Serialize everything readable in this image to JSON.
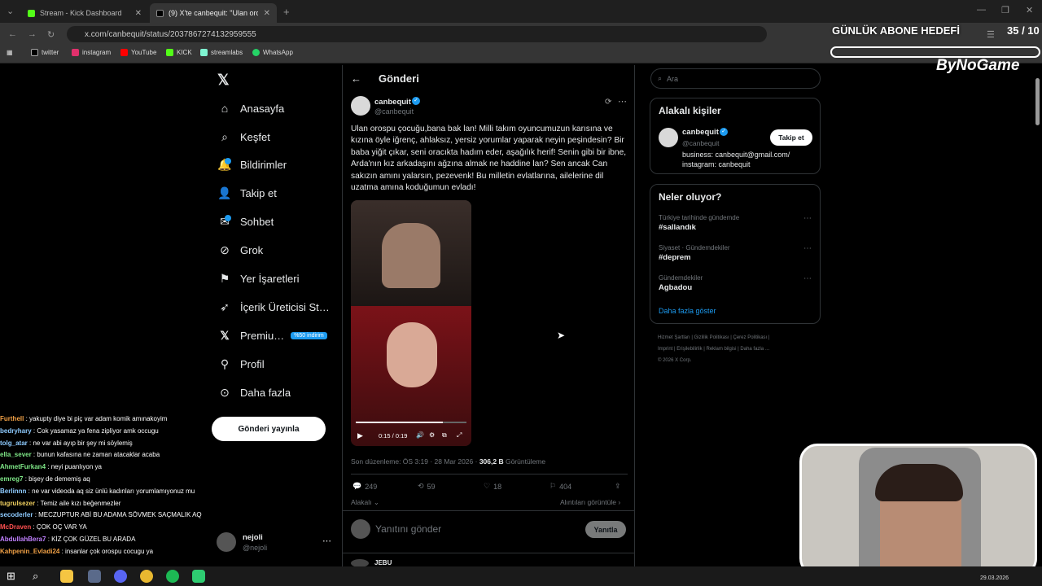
{
  "browser": {
    "tabs": [
      {
        "label": "Stream - Kick Dashboard"
      },
      {
        "label": "(9) X'te canbequit: \"Ulan orosp…"
      }
    ],
    "url": "x.com/canbequit/status/2037867274132959555",
    "bookmarks": [
      "twitter",
      "instagram",
      "YouTube",
      "KICK",
      "streamlabs",
      "WhatsApp"
    ]
  },
  "overlay": {
    "goal_title": "GÜNLÜK ABONE HEDEFİ",
    "goal_count": "35 / 10",
    "brand": "ByNoGame"
  },
  "sidebar": {
    "items": [
      {
        "label": "Anasayfa",
        "icon": "home-icon"
      },
      {
        "label": "Keşfet",
        "icon": "search-icon"
      },
      {
        "label": "Bildirimler",
        "icon": "bell-icon"
      },
      {
        "label": "Takip et",
        "icon": "follow-icon"
      },
      {
        "label": "Sohbet",
        "icon": "mail-icon"
      },
      {
        "label": "Grok",
        "icon": "grok-icon"
      },
      {
        "label": "Yer İşaretleri",
        "icon": "bookmark-icon"
      },
      {
        "label": "İçerik Üreticisi St…",
        "icon": "rocket-icon"
      },
      {
        "label": "Premiu…",
        "icon": "x-logo-icon"
      },
      {
        "label": "Profil",
        "icon": "person-icon"
      },
      {
        "label": "Daha fazla",
        "icon": "more-circle-icon"
      }
    ],
    "premium_badge": "%50 indirim",
    "post_button": "Gönderi yayınla",
    "account": {
      "name": "nejoli",
      "handle": "@nejoli"
    }
  },
  "chat": [
    {
      "user": "Furthell",
      "color": "#f0a046",
      "msg": "yakupty diye bi piç var adam komik amınakoyim"
    },
    {
      "user": "bedryhary",
      "color": "#8ecbff",
      "msg": "Cok yasamaz ya fena zipliyor amk occugu"
    },
    {
      "user": "tolg_atar",
      "color": "#8ecbff",
      "msg": "ne var abi ayıp bir şey mi söylemiş"
    },
    {
      "user": "ella_sever",
      "color": "#7ee787",
      "msg": "bunun kafasına ne zaman atacaklar acaba"
    },
    {
      "user": "AhmetFurkan4",
      "color": "#7ee787",
      "msg": "neyi puanlıyon ya"
    },
    {
      "user": "emreg7",
      "color": "#7ee787",
      "msg": "bişey de dememiş aq"
    },
    {
      "user": "Berlinnn",
      "color": "#8ecbff",
      "msg": "ne var videoda aq siz ünlü kadınları yorumlamıyonuz mu"
    },
    {
      "user": "tugrulsezer",
      "color": "#f0d060",
      "msg": "Temiz aile kızı beğenmezler"
    },
    {
      "user": "secoderler",
      "color": "#8ecbff",
      "msg": "MECZUPTUR ABİ BU ADAMA SÖVMEK SAÇMALIK AQ"
    },
    {
      "user": "McDraven",
      "color": "#ff5050",
      "msg": "ÇOK OÇ VAR YA"
    },
    {
      "user": "AbdullahBera7",
      "color": "#c080ff",
      "msg": "KİZ ÇOK GÜZEL BU ARADA"
    },
    {
      "user": "Kahpenin_Evladi24",
      "color": "#f0a046",
      "msg": "insanlar çok orospu cocugu ya"
    }
  ],
  "post": {
    "header": "Gönderi",
    "author": {
      "name": "canbequit",
      "handle": "@canbequit"
    },
    "text": "Ulan orospu çocuğu,bana bak lan! Milli takım oyuncumuzun karısına ve kızına öyle iğrenç, ahlaksız, yersiz yorumlar yaparak neyin peşindesin? Bir baba yiğit çıkar, seni oracıkta hadım eder, aşağılık herif! Senin gibi bir ibne, Arda'nın kız arkadaşını ağzına almak ne haddine lan? Sen ancak Can sakızın amını yalarsın, pezevenk! Bu milletin evlatlarına, ailelerine dil uzatma amına koduğumun evladı!",
    "video_time": "0:15 / 0:19",
    "video_progress": 0.79,
    "edited": "Son düzenleme: ÖS 3:19 · 28 Mar 2026 · ",
    "views": "306,2 B",
    "views_label": "Görüntüleme",
    "replies": "249",
    "reposts": "59",
    "likes": "18",
    "bookmarks": "404",
    "related": "Alakalı",
    "quotes": "Alıntıları görüntüle",
    "reply_placeholder": "Yanıtını gönder",
    "reply_button": "Yanıtla",
    "next_author": "JEBU"
  },
  "right": {
    "search_placeholder": "Ara",
    "related_title": "Alakalı kişiler",
    "related_person": {
      "name": "canbequit",
      "handle": "@canbequit",
      "bio1": "business: canbequit@gmail.com/",
      "bio2": "instagram: canbequit",
      "follow": "Takip et"
    },
    "trends_title": "Neler oluyor?",
    "trends": [
      {
        "meta": "Türkiye tarihinde gündemde",
        "name": "#sallandık"
      },
      {
        "meta": "Siyaset · Gündemdekiler",
        "name": "#deprem"
      },
      {
        "meta": "Gündemdekiler",
        "name": "Agbadou"
      }
    ],
    "show_more": "Daha fazla göster",
    "footer": [
      "Hizmet Şartları",
      "Gizlilik Politikası",
      "Çerez Politikası",
      "Imprint",
      "Erişilebilirlik",
      "Reklam bilgisi",
      "Daha fazla …",
      "© 2026 X Corp."
    ]
  },
  "taskbar": {
    "date": "29.03.2026"
  }
}
